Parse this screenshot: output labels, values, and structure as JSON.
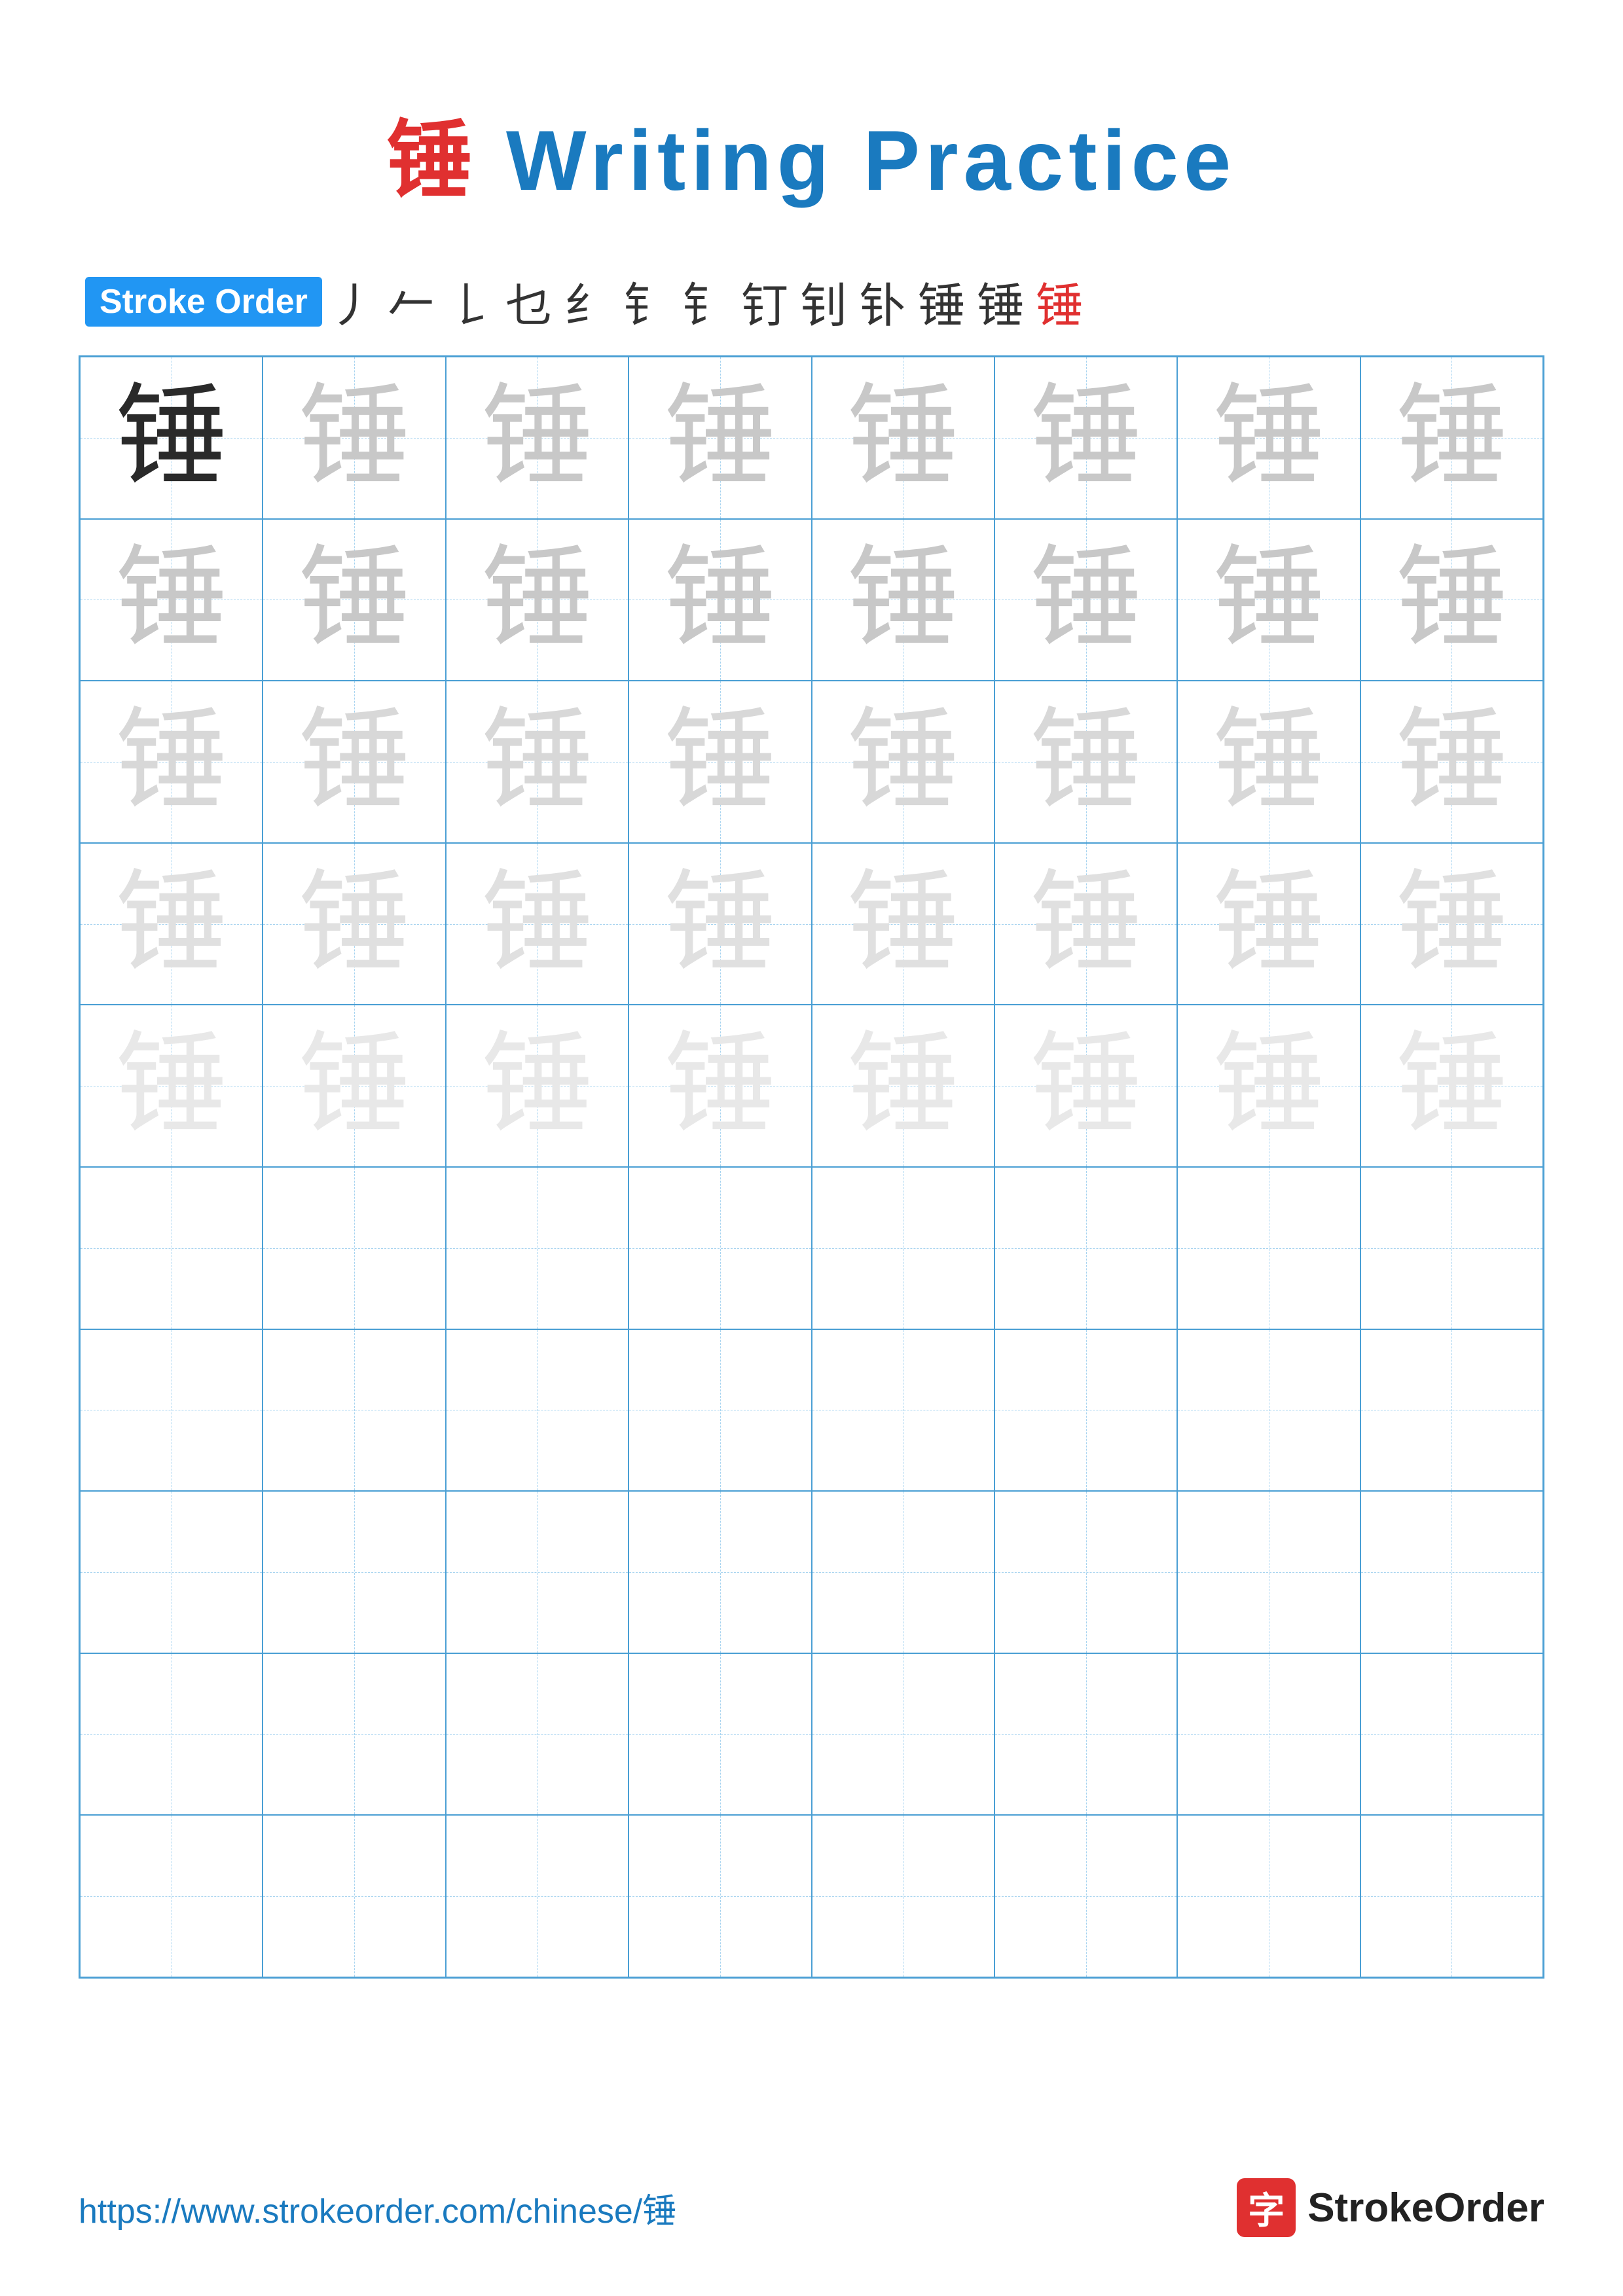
{
  "title": {
    "char": "锤",
    "rest": " Writing Practice"
  },
  "stroke_order": {
    "badge_label": "Stroke Order",
    "strokes": [
      "丿",
      "𠂉",
      "𠄌",
      "乜",
      "纟",
      "钅",
      "钅",
      "钉",
      "钊",
      "钋",
      "锤",
      "锤",
      "锤"
    ]
  },
  "grid": {
    "char": "锤",
    "rows": 10,
    "cols": 8,
    "filled_rows": 5,
    "opacity_levels": [
      "dark",
      "light1",
      "light2",
      "light3",
      "light4"
    ]
  },
  "footer": {
    "url": "https://www.strokeorder.com/chinese/锤",
    "brand_char": "字",
    "brand_name": "StrokeOrder"
  }
}
